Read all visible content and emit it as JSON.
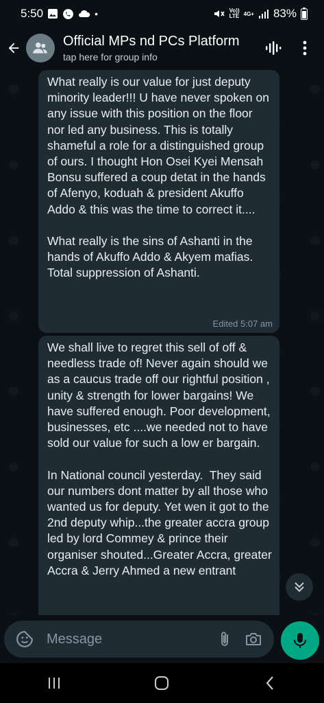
{
  "status_bar": {
    "time": "5:50",
    "dot": "•",
    "network": "Vo))\nLTE",
    "net4g": "4G+",
    "battery": "83%"
  },
  "header": {
    "title": "Official MPs nd PCs Platform",
    "subtitle": "tap here for group info",
    "icons": [
      "back-arrow-icon",
      "group-avatar-icon",
      "voice-chat-icon",
      "more-options-icon"
    ]
  },
  "messages": [
    {
      "text": "What really is our value for just deputy minority leader!!! U have never spoken on any issue with this position on the floor nor led any business. This is totally shameful a role for a distinguished group of ours. I thought Hon Osei Kyei Mensah Bonsu suffered a coup detat in the hands of Afenyo, koduah & president Akuffo Addo & this was the time to correct it....\n\nWhat really is the sins of Ashanti in the hands of Akuffo Addo & Akyem mafias. Total suppression of Ashanti.",
      "meta": "Edited  5:07 am"
    },
    {
      "text": "We shall live to regret this sell of off & needless trade of! Never again should we as a caucus trade off our rightful position , unity & strength for lower bargains! We have suffered enough. Poor development, businesses, etc ....we needed not to have sold our value for such a low er bargain.\n\nIn National council yesterday.  They said our numbers dont matter by all those who wanted us for deputy. Yet wen it got to the 2nd deputy whip...the greater accra group led by lord Commey & prince their organiser shouted...Greater Accra, greater Accra & Jerry Ahmed a new entrant"
    }
  ],
  "composer": {
    "placeholder": "Message",
    "icons": [
      "sticker-icon",
      "attach-icon",
      "camera-icon",
      "mic-icon"
    ]
  },
  "colors": {
    "background": "#0b1014",
    "bubble": "#1f2c34",
    "accent": "#00a884",
    "meta": "#8696a0"
  }
}
